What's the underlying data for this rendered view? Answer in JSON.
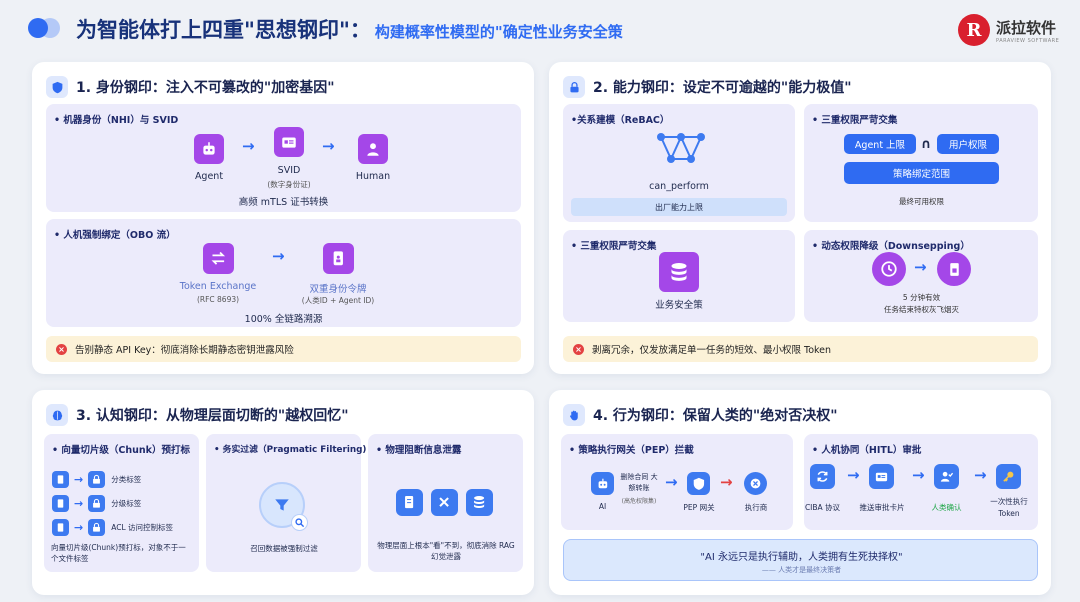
{
  "header": {
    "title": "为智能体打上四重\"思想钢印\"：",
    "subtitle": "构建概率性模型的\"确定性业务安全策",
    "brand_mark": "R",
    "brand_name": "派拉软件",
    "brand_en": "PARAVIEW SOFTWARE"
  },
  "card1": {
    "title": "1. 身份钢印：注入不可篡改的\"加密基因\"",
    "p1": {
      "heading": "• 机器身份（NHI）与 SVID",
      "agent": "Agent",
      "svid": "SVID",
      "svid_sub": "(数字身份证)",
      "human": "Human",
      "footer": "高频 mTLS 证书转换"
    },
    "p2": {
      "heading": "• 人机强制绑定（OBO 流）",
      "token_exchange": "Token Exchange",
      "token_exchange_sub": "(RFC 8693)",
      "dual_token": "双重身份令牌",
      "dual_token_sub": "(人类ID + Agent ID)",
      "footer": "100% 全链路溯源"
    },
    "warning": "告别静态 API Key：彻底消除长期静态密钥泄露风险"
  },
  "card2": {
    "title": "2. 能力钢印：设定不可逾越的\"能力极值\"",
    "p1": {
      "heading": "•关系建模（ReBAC）",
      "label": "can_perform",
      "footer": "出厂能力上限"
    },
    "p2": {
      "heading": "• 三重权限严苛交集",
      "agent_limit": "Agent 上限",
      "intersect": "∩",
      "user_perm": "用户权限",
      "policy_scope": "策略绑定范围",
      "footer": "最终可用权限"
    },
    "p3": {
      "heading": "• 三重权限严苛交集",
      "label": "业务安全策"
    },
    "p4": {
      "heading": "• 动态权限降级（Downsepping）",
      "line1": "5 分钟有效",
      "line2": "任务结束特权灰飞烟灭"
    },
    "warning": "剥离冗余，仅发放满足单一任务的短效、最小权限 Token"
  },
  "card3": {
    "title": "3. 认知钢印：从物理层面切断的\"越权回忆\"",
    "p1": {
      "heading": "• 向量切片级（Chunk）预打标",
      "row1": "分类标签",
      "row2": "分级标签",
      "row3": "ACL 访问控制标签",
      "footer": "向量切片级(Chunk)预打标，对象不于一个文件标签"
    },
    "p2": {
      "heading": "• 务实过滤（Pragmatic Filtering)",
      "footer": "召回数据被强制过滤"
    },
    "p3": {
      "heading": "• 物理阻断信息泄露",
      "footer": "物理层面上根本\"看\"不到，彻底消除 RAG 幻觉泄露"
    }
  },
  "card4": {
    "title": "4. 行为钢印：保留人类的\"绝对否决权\"",
    "p1": {
      "heading": "• 策略执行网关（PEP）拦截",
      "ai": "AI",
      "delete_label": "删除合同 大额转账",
      "delete_sub": "(高危权限集)",
      "pep": "PEP 网关",
      "executed": "执行商"
    },
    "p2": {
      "heading": "• 人机协同（HITL）审批",
      "ciba": "CIBA 协议",
      "push": "推送审批卡片",
      "confirm": "人类确认",
      "once_token": "一次性执行 Token"
    },
    "quote": "\"AI 永远只是执行辅助，人类拥有生死抉择权\"",
    "quote_by": "—— 人类才是最终决策者"
  },
  "colors": {
    "primary": "#2f6bf2",
    "purple": "#a447e8",
    "warning_bg": "#fcf2d8",
    "error": "#e34242",
    "panel_bg": "#ecebfb",
    "confirm_green": "#1fa648"
  },
  "icons": [
    "logo-dots-icon",
    "shield-icon",
    "lock-icon",
    "brain-icon",
    "hand-icon",
    "robot-icon",
    "id-card-icon",
    "person-icon",
    "exchange-icon",
    "token-icon",
    "network-icon",
    "database-icon",
    "clock-icon",
    "document-icon",
    "filter-icon",
    "close-icon",
    "sync-icon",
    "check-person-icon",
    "key-icon"
  ]
}
